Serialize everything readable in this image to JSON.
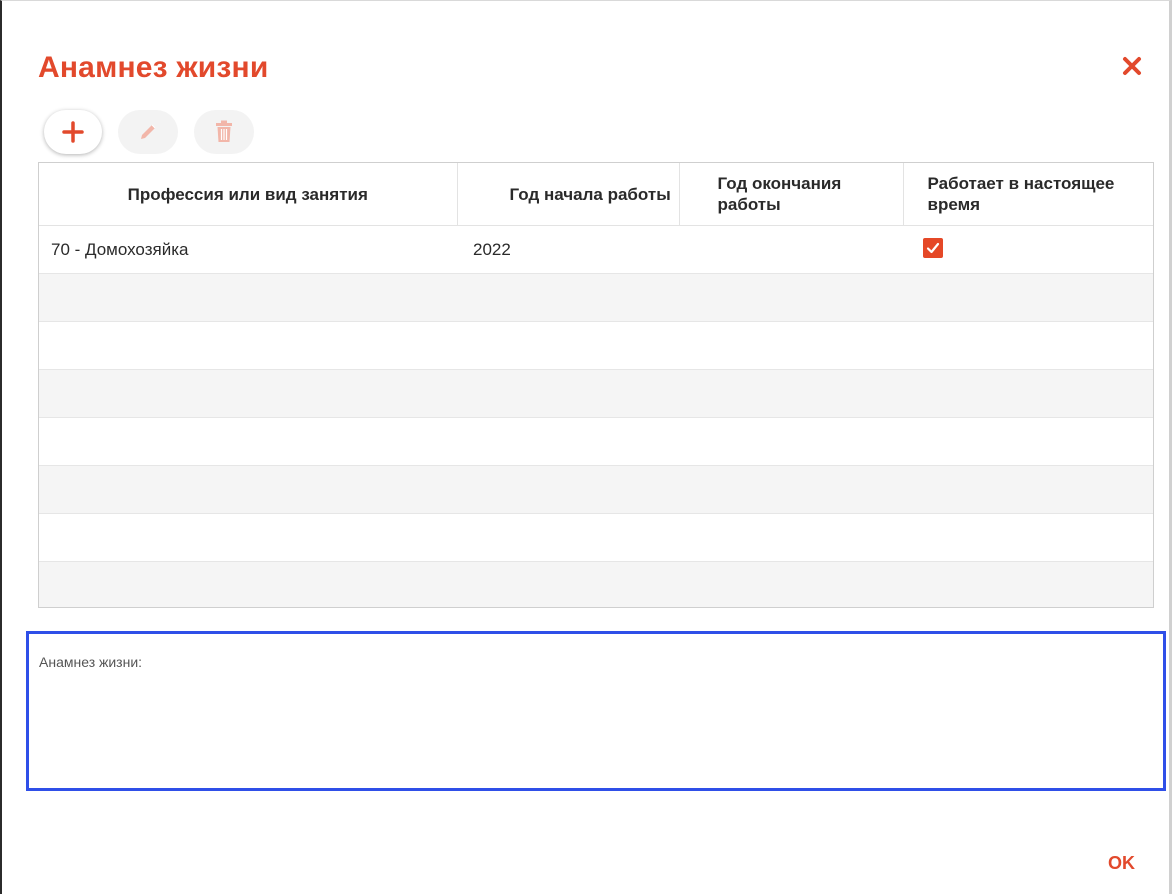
{
  "dialog": {
    "title": "Анамнез жизни",
    "close_icon": "close-icon"
  },
  "toolbar": {
    "buttons": [
      {
        "icon": "plus-icon",
        "enabled": true
      },
      {
        "icon": "pencil-icon",
        "enabled": false
      },
      {
        "icon": "trash-icon",
        "enabled": false
      }
    ]
  },
  "table": {
    "columns": [
      "Профессия или вид занятия",
      "Год начала работы",
      "Год окончания работы",
      "Работает в настоящее время"
    ],
    "rows": [
      {
        "profession": "70 - Домохозяйка",
        "start_year": "2022",
        "end_year": "",
        "currently_working": true
      }
    ]
  },
  "notes": {
    "label": "Анамнез жизни:",
    "value": ""
  },
  "footer": {
    "ok_label": "OK"
  },
  "colors": {
    "accent": "#e2492c",
    "focus_border": "#2f4fe8"
  }
}
